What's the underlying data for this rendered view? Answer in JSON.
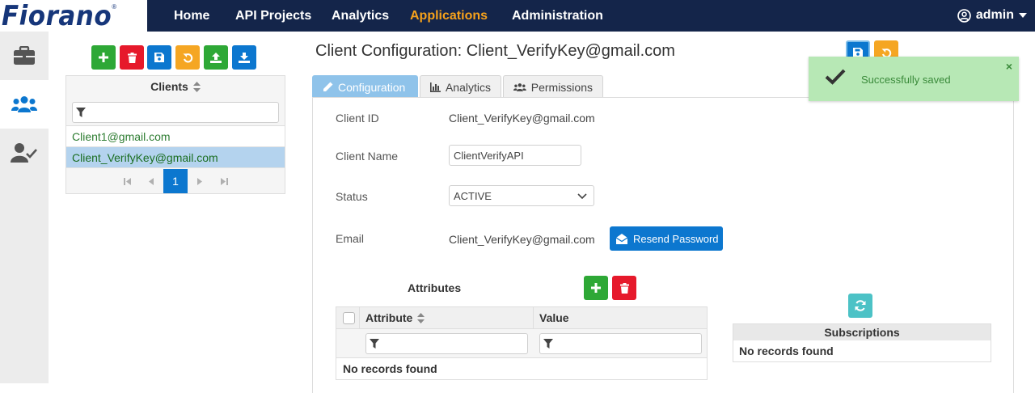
{
  "brand": {
    "logo_text": "Fiorano",
    "trademark": "®"
  },
  "nav": {
    "items": [
      {
        "label": "Home"
      },
      {
        "label": "API Projects"
      },
      {
        "label": "Analytics"
      },
      {
        "label": "Applications"
      },
      {
        "label": "Administration"
      }
    ],
    "active": "Applications",
    "user": "admin"
  },
  "rail": {
    "items": [
      "briefcase-icon",
      "users-icon",
      "user-check-icon"
    ],
    "active": "users-icon"
  },
  "clients": {
    "header": "Clients",
    "filter_value": "",
    "rows": [
      "Client1@gmail.com",
      "Client_VerifyKey@gmail.com"
    ],
    "selected": "Client_VerifyKey@gmail.com",
    "current_page": "1"
  },
  "page_title": "Client Configuration: Client_VerifyKey@gmail.com",
  "tabs": [
    {
      "label": "Configuration"
    },
    {
      "label": "Analytics"
    },
    {
      "label": "Permissions"
    }
  ],
  "form": {
    "client_id_label": "Client ID",
    "client_id": "Client_VerifyKey@gmail.com",
    "client_name_label": "Client Name",
    "client_name": "ClientVerifyAPI",
    "status_label": "Status",
    "status": "ACTIVE",
    "email_label": "Email",
    "email": "Client_VerifyKey@gmail.com",
    "resend_label": "Resend Password"
  },
  "attributes": {
    "title": "Attributes",
    "col_attribute": "Attribute",
    "col_value": "Value",
    "empty": "No records found"
  },
  "subscriptions": {
    "title": "Subscriptions",
    "empty": "No records found"
  },
  "toast": {
    "message": "Successfully saved",
    "close": "×"
  },
  "colors": {
    "navbar": "#14254a",
    "active_nav": "#f7a21b",
    "primary": "#0c77cf",
    "success": "#2ea836",
    "danger": "#e6192b",
    "warning": "#f5a623"
  }
}
